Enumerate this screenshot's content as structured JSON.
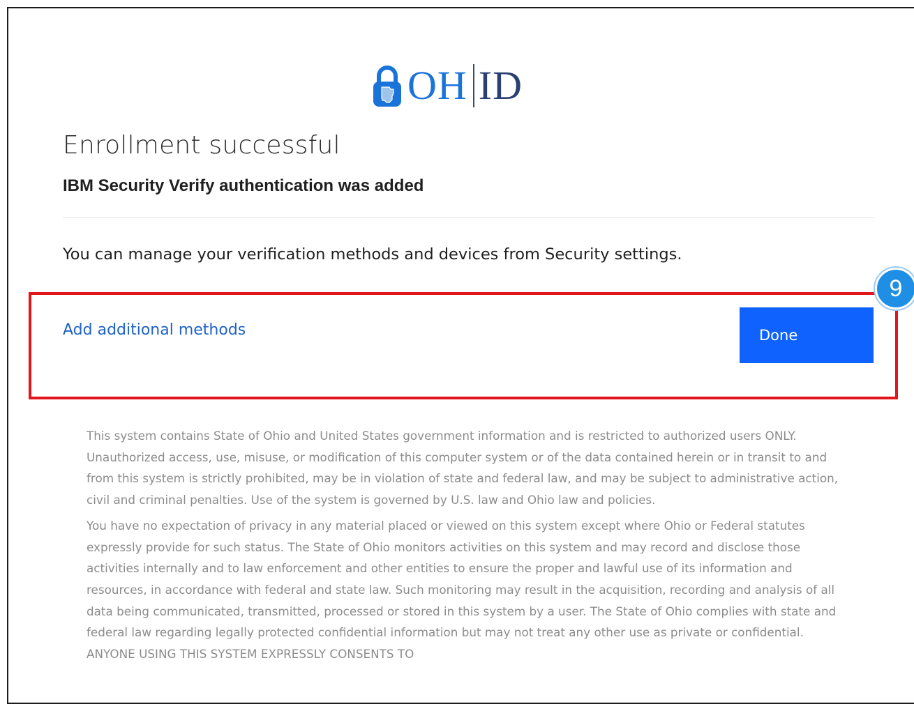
{
  "logo": {
    "oh_text": "OH",
    "id_text": "ID"
  },
  "page": {
    "title": "Enrollment successful",
    "subtitle": "IBM Security Verify authentication was added",
    "manage_text": "You can manage your verification methods and devices from Security settings."
  },
  "actions": {
    "add_methods_label": "Add additional methods",
    "done_label": "Done"
  },
  "annotation": {
    "step_number": "9"
  },
  "disclaimer": {
    "paragraph_1": "This system contains State of Ohio and United States government information and is restricted to authorized users ONLY. Unauthorized access, use, misuse, or modification of this computer system or of the data contained herein or in transit to and from this system is strictly prohibited, may be in violation of state and federal law, and may be subject to administrative action, civil and criminal penalties. Use of the system is governed by U.S. law and Ohio law and policies.",
    "paragraph_2": "You have no expectation of privacy in any material placed or viewed on this system except where Ohio or Federal statutes expressly provide for such status. The State of Ohio monitors activities on this system and may record and disclose those activities internally and to law enforcement and other entities to ensure the proper and lawful use of its information and resources, in accordance with federal and state law. Such monitoring may result in the acquisition, recording and analysis of all data being communicated, transmitted, processed or stored in this system by a user. The State of Ohio complies with state and federal law regarding legally protected confidential information but may not treat any other use as private or confidential. ANYONE USING THIS SYSTEM EXPRESSLY CONSENTS TO"
  },
  "colors": {
    "brand_blue": "#1a73d9",
    "brand_navy": "#2b3f73",
    "primary_button": "#0f62fe",
    "link": "#1f63c7",
    "highlight": "#e3141b",
    "badge": "#1f8fe6"
  }
}
